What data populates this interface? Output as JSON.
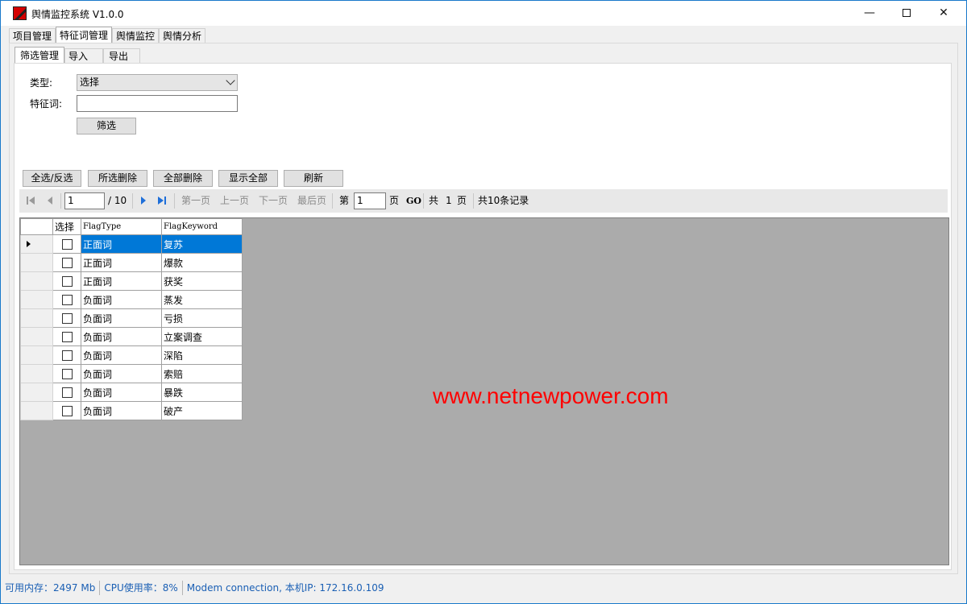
{
  "window": {
    "title": "舆情监控系统 V1.0.0",
    "min_icon": "minimize-icon",
    "max_icon": "maximize-icon",
    "close_icon": "close-icon"
  },
  "main_tabs": [
    "项目管理",
    "特征词管理",
    "舆情监控",
    "舆情分析"
  ],
  "sub_tabs": [
    "筛选管理",
    "导入",
    "导出"
  ],
  "filter": {
    "type_label": "类型:",
    "type_value": "选择",
    "keyword_label": "特征词:",
    "keyword_value": "",
    "filter_button": "筛选"
  },
  "actions": [
    "全选/反选",
    "所选删除",
    "全部删除",
    "显示全部",
    "刷新"
  ],
  "pager": {
    "current_page": "1",
    "total_pages": "/ 10",
    "first": "第一页",
    "prev": "上一页",
    "next": "下一页",
    "last": "最后页",
    "goto_prefix": "第",
    "goto_value": "1",
    "goto_suffix": "页",
    "go": "GO",
    "total_prefix": "共",
    "total_value": "1",
    "total_suffix": "页",
    "records": "共10条记录"
  },
  "grid": {
    "columns": [
      "选择",
      "FlagType",
      "FlagKeyword"
    ],
    "rows": [
      [
        "正面词",
        "复苏"
      ],
      [
        "正面词",
        "爆款"
      ],
      [
        "正面词",
        "获奖"
      ],
      [
        "负面词",
        "蒸发"
      ],
      [
        "负面词",
        "亏损"
      ],
      [
        "负面词",
        "立案调查"
      ],
      [
        "负面词",
        "深陷"
      ],
      [
        "负面词",
        "索赔"
      ],
      [
        "负面词",
        "暴跌"
      ],
      [
        "负面词",
        "破产"
      ]
    ],
    "selected_row": 0
  },
  "watermark": "www.netnewpower.com",
  "status": [
    "可用内存：2497 Mb",
    "CPU使用率：8%",
    "Modem connection,  本机IP: 172.16.0.109"
  ],
  "colors": {
    "selection": "#0078d7",
    "status_text": "#1a5fb4",
    "watermark": "#ff0000",
    "grid_bg": "#ababab"
  }
}
